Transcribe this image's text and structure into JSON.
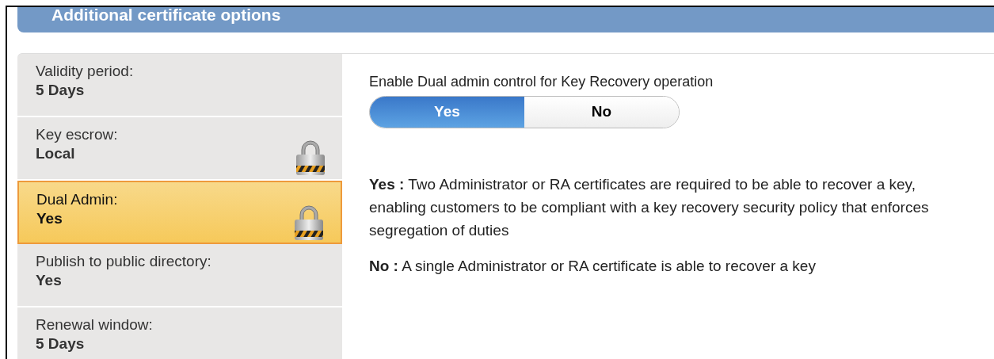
{
  "header": {
    "title": "Additional certificate options"
  },
  "sidebar": {
    "items": [
      {
        "label": "Validity period:",
        "value": "5 Days",
        "locked": false,
        "selected": false
      },
      {
        "label": "Key escrow:",
        "value": "Local",
        "locked": true,
        "selected": false
      },
      {
        "label": "Dual Admin:",
        "value": "Yes",
        "locked": true,
        "selected": true
      },
      {
        "label": "Publish to public directory:",
        "value": "Yes",
        "locked": false,
        "selected": false
      },
      {
        "label": "Renewal window:",
        "value": "5 Days",
        "locked": false,
        "selected": false
      }
    ]
  },
  "setting": {
    "label": "Enable Dual admin control for Key Recovery operation",
    "options": [
      {
        "label": "Yes",
        "selected": true
      },
      {
        "label": "No",
        "selected": false
      }
    ]
  },
  "descriptions": [
    "**Yes :** Two Administrator or RA certificates are required to be able to recover a key, enabling customers to be compliant with a key recovery security policy that enforces segregation of duties",
    "**No :** A single Administrator or RA certificate is able to recover a key"
  ]
}
